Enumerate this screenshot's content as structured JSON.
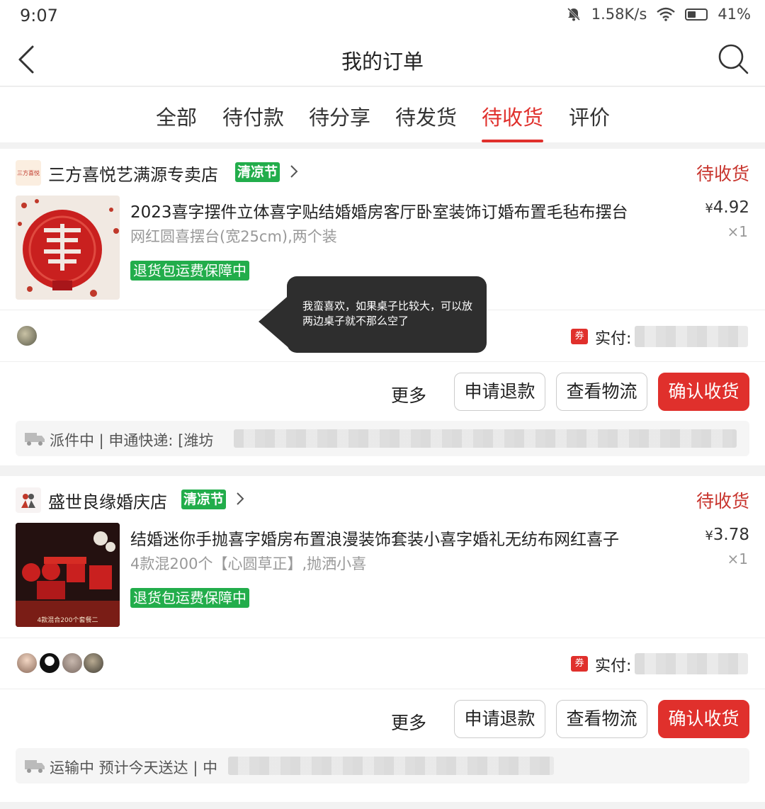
{
  "status_bar": {
    "time": "9:07",
    "speed": "1.58K/s",
    "battery": "41%"
  },
  "nav": {
    "title": "我的订单"
  },
  "tabs": [
    {
      "label": "全部"
    },
    {
      "label": "待付款"
    },
    {
      "label": "待分享"
    },
    {
      "label": "待发货"
    },
    {
      "label": "待收货",
      "active": true
    },
    {
      "label": "评价"
    }
  ],
  "orders": [
    {
      "store_name": "三方喜悦艺满源专卖店",
      "store_logo_text": "三方喜悦",
      "promo_badge": "清凉节",
      "status": "待收货",
      "product_title": "2023喜字摆件立体喜字贴结婚婚房客厅卧室装饰订婚布置毛毡布摆台",
      "product_spec": "网红圆喜摆台(宽25cm),两个装",
      "guarantee": "退货包运费保障中",
      "price_symbol": "¥",
      "price": "4.92",
      "quantity": "×1",
      "coupon_icon": "券",
      "paid_label": "实付:",
      "buttons": {
        "more": "更多",
        "refund": "申请退款",
        "logistics": "查看物流",
        "confirm": "确认收货"
      },
      "logistics_text": "派件中 | 申通快递: [潍坊"
    },
    {
      "store_name": "盛世良缘婚庆店",
      "promo_badge": "清凉节",
      "status": "待收货",
      "product_title": "结婚迷你手抛喜字婚房布置浪漫装饰套装小喜字婚礼无纺布网红喜子",
      "product_spec": "4款混200个【心圆草正】,抛洒小喜",
      "product_image_caption": "4款混合200个套餐二",
      "guarantee": "退货包运费保障中",
      "price_symbol": "¥",
      "price": "3.78",
      "quantity": "×1",
      "coupon_icon": "券",
      "paid_label": "实付:",
      "buttons": {
        "more": "更多",
        "refund": "申请退款",
        "logistics": "查看物流",
        "confirm": "确认收货"
      },
      "logistics_text": "运输中 预计今天送达 | 中"
    }
  ],
  "tooltip": {
    "text": "我蛮喜欢，如果桌子比较大，可以放两边桌子就不那么空了"
  },
  "colors": {
    "accent": "#e0302c",
    "status_red": "#c8352e",
    "promo_green": "#22ad4b"
  },
  "icons": [
    "back-icon",
    "search-icon",
    "chevron-right-icon",
    "truck-icon",
    "bell-muted-icon",
    "wifi-icon",
    "battery-icon"
  ]
}
